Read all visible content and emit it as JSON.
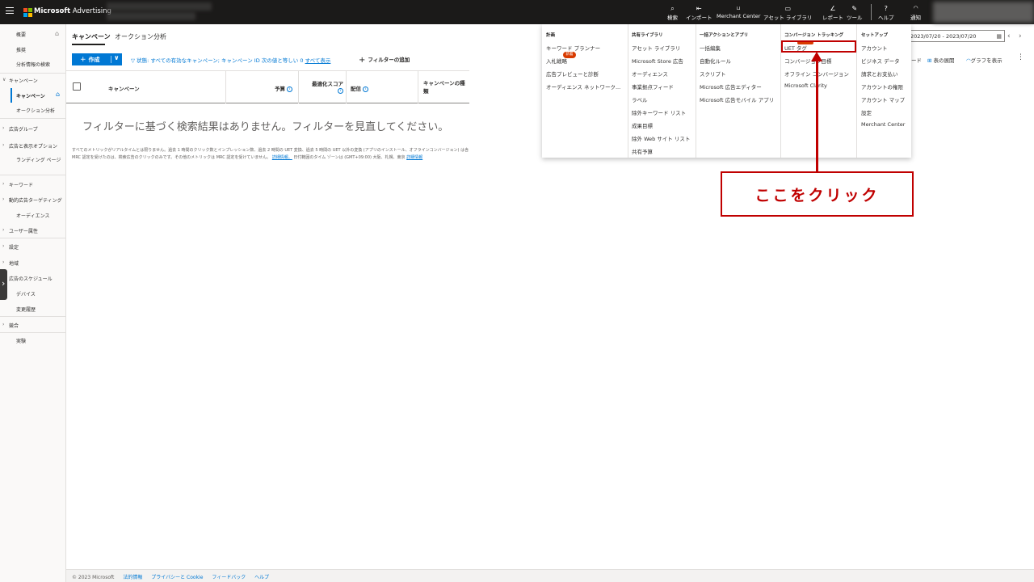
{
  "topbar": {
    "brand_ms": "Microsoft",
    "brand_product": "Advertising",
    "nav": [
      {
        "label": "検索",
        "icon": "search-icon",
        "glyph": "⌕"
      },
      {
        "label": "インポート",
        "icon": "import-icon",
        "glyph": "⇤"
      },
      {
        "label": "Merchant Center",
        "icon": "cart-icon",
        "glyph": "🛒"
      },
      {
        "label": "アセット ライブラリ",
        "icon": "asset-library-icon",
        "glyph": "▭"
      },
      {
        "label": "レポート",
        "icon": "report-icon",
        "glyph": "∠"
      },
      {
        "label": "ツール",
        "icon": "tools-icon",
        "glyph": "✎"
      },
      {
        "label": "ヘルプ",
        "icon": "help-icon",
        "glyph": "?"
      },
      {
        "label": "通知",
        "icon": "bell-icon",
        "glyph": "🔔"
      }
    ]
  },
  "sidebar": {
    "items": [
      {
        "label": "概要"
      },
      {
        "label": "推奨"
      },
      {
        "label": "分析情報の検索"
      },
      {
        "label": "キャンペーン"
      },
      {
        "label": "キャンペーン"
      },
      {
        "label": "オークション分析"
      },
      {
        "label": "広告グループ"
      },
      {
        "label": "広告と表示オプション"
      },
      {
        "label": "ランディング ページ"
      },
      {
        "label": "キーワード"
      },
      {
        "label": "動的広告ターゲティング"
      },
      {
        "label": "オーディエンス"
      },
      {
        "label": "ユーザー属性"
      },
      {
        "label": "設定"
      },
      {
        "label": "地域"
      },
      {
        "label": "広告のスケジュール"
      },
      {
        "label": "デバイス"
      },
      {
        "label": "変更履歴"
      },
      {
        "label": "競合"
      },
      {
        "label": "実験"
      }
    ]
  },
  "main": {
    "tabs": [
      {
        "label": "キャンペーン"
      },
      {
        "label": "オークション分析"
      }
    ],
    "create_label": "作成",
    "filter_text": "状態: すべての有効なキャンペーン; キャンペーン ID 次の値と等しい 0",
    "filter_all": "すべて表示",
    "add_filter": "フィルターの追加",
    "columns": [
      "キャンペーン",
      "予算",
      "最適化スコア",
      "配信",
      "キャンペーンの種類"
    ],
    "empty_message": "フィルターに基づく検索結果はありません。フィルターを見直してください。",
    "footnote_line1": "すべてのメトリックがリアルタイムとは限りません。過去 1 時間のクリック数とインプレッション数、過去 2 時間の UET 変換、過去 5 時間の UET 以外の変換 (アプリのインストール、オフラインコンバージョン) は含",
    "footnote_line2": "MRC 認定を受けたのは、検索広告のクリックのみです。その他のメトリックは MRC 認定を受けていません。",
    "footnote_link1": "詳細情報。",
    "footnote_line2b": "日付範囲のタイム ゾーンは (GMT+09:00) 大阪、札幌、東京",
    "footnote_link2": "詳細情報"
  },
  "right_toolbar": {
    "date_range": "2023/07/20 - 2023/07/20",
    "download_fragment": "ード",
    "table_columns": "表の展開",
    "show_chart": "グラフを表示"
  },
  "mega_menu": {
    "columns": [
      {
        "header": "計画",
        "items": [
          "キーワード プランナー",
          "入札戦略",
          "広告プレビューと診断",
          "オーディエンス ネットワーク..."
        ]
      },
      {
        "header": "共有ライブラリ",
        "items": [
          "アセット ライブラリ",
          "Microsoft Store 広告",
          "オーディエンス",
          "事業拠点フィード",
          "ラベル",
          "除外キーワード リスト",
          "成果目標",
          "除外 Web サイト リスト",
          "共有予算"
        ]
      },
      {
        "header": "一括アクションとアプリ",
        "items": [
          "一括編集",
          "自動化ルール",
          "スクリプト",
          "Microsoft 広告エディター",
          "Microsoft 広告モバイル アプリ"
        ]
      },
      {
        "header": "コンバージョン トラッキング",
        "items": [
          "UET タグ",
          "コンバージョン目標",
          "オフライン コンバージョン",
          "Microsoft Clarity"
        ]
      },
      {
        "header": "セットアップ",
        "items": [
          "アカウント",
          "ビジネス データ",
          "請求とお支払い",
          "アカウントの権限",
          "アカウント マップ",
          "設定",
          "Merchant Center"
        ]
      }
    ],
    "new_badge": "新着"
  },
  "annotation": {
    "callout_text": "ここをクリック",
    "color": "#c00000"
  },
  "footer": {
    "copyright": "© 2023 Microsoft",
    "links": [
      "法的情報",
      "プライバシーと Cookie",
      "フィードバック",
      "ヘルプ"
    ]
  },
  "colors": {
    "accent": "#0078d4",
    "topbar": "#1b1a19",
    "annotation": "#c00000"
  }
}
